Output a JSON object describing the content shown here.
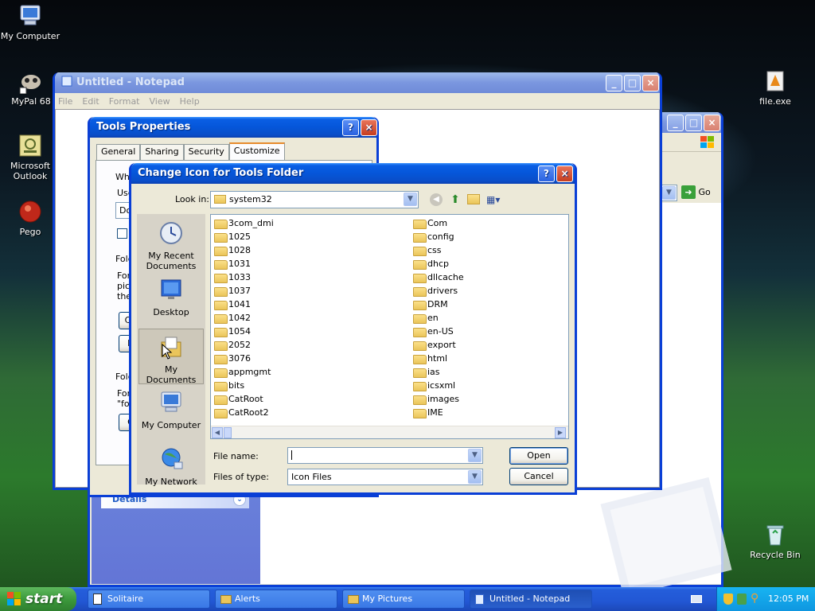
{
  "desktop": {
    "icons": [
      {
        "label": "My Computer",
        "icon": "computer-icon"
      },
      {
        "label": "MyPal 68",
        "icon": "mypal-icon"
      },
      {
        "label": "Microsoft Outlook",
        "icon": "outlook-icon"
      },
      {
        "label": "Pego",
        "icon": "pego-icon"
      },
      {
        "label": "file.exe",
        "icon": "exe-icon"
      },
      {
        "label": "Recycle Bin",
        "icon": "recycle-bin-icon"
      }
    ]
  },
  "notepad": {
    "title": "Untitled - Notepad",
    "menu": [
      "File",
      "Edit",
      "Format",
      "View",
      "Help"
    ]
  },
  "explorer": {
    "go_label": "Go",
    "details_label": "Details"
  },
  "tools_properties": {
    "title": "Tools Properties",
    "tabs": [
      "General",
      "Sharing",
      "Security",
      "Customize"
    ],
    "active_tab": "Customize",
    "fragments": [
      "Wha",
      "Use",
      "Do",
      "Fold",
      "For",
      "pict",
      "the",
      "Ch",
      "R",
      "Fold",
      "For",
      "\"fol",
      "C"
    ]
  },
  "dialog": {
    "title": "Change Icon for Tools Folder",
    "look_in_label": "Look in:",
    "look_in_value": "system32",
    "places": [
      "My Recent Documents",
      "Desktop",
      "My Documents",
      "My Computer",
      "My Network"
    ],
    "selected_place": "My Documents",
    "files_col1": [
      "3com_dmi",
      "1025",
      "1028",
      "1031",
      "1033",
      "1037",
      "1041",
      "1042",
      "1054",
      "2052",
      "3076",
      "appmgmt",
      "bits",
      "CatRoot",
      "CatRoot2"
    ],
    "files_col2": [
      "Com",
      "config",
      "css",
      "dhcp",
      "dllcache",
      "drivers",
      "DRM",
      "en",
      "en-US",
      "export",
      "html",
      "ias",
      "icsxml",
      "images",
      "IME"
    ],
    "file_name_label": "File name:",
    "file_name_value": "",
    "file_type_label": "Files of type:",
    "file_type_value": "Icon Files",
    "open_label": "Open",
    "cancel_label": "Cancel"
  },
  "taskbar": {
    "start_label": "start",
    "tasks": [
      "Solitaire",
      "Alerts",
      "My Pictures",
      "Untitled - Notepad"
    ],
    "clock": "12:05 PM"
  }
}
